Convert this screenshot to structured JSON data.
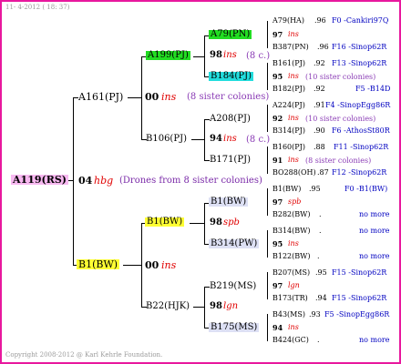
{
  "header_date": "11-  4-2012 ( 18: 37)",
  "copyright": "Copyright 2008-2012 @ Karl Kehrle Foundation.",
  "root": {
    "id": "A119(RS)",
    "year": "04",
    "breed": "hbg",
    "drones": "(Drones from 8 sister colonies)"
  },
  "p1": {
    "id": "A161(PJ)",
    "year": "00",
    "breed": "ins",
    "sisters": "(8 sister colonies)"
  },
  "p2": {
    "id": "B1(BW)",
    "year": "00",
    "breed": "ins"
  },
  "g1": {
    "id": "A199(PJ)",
    "year": "98",
    "breed": "ins",
    "sisters": "(8 c.)"
  },
  "g2": {
    "id": "B106(PJ)",
    "year": "94",
    "breed": "ins",
    "sisters": "(8 c.)"
  },
  "g3": {
    "id": "B1(BW)",
    "year": "98",
    "breed": "spb"
  },
  "g4": {
    "id": "B22(HJK)",
    "year": "98",
    "breed": "lgn"
  },
  "ggg": [
    {
      "id": "A79(PN)"
    },
    {
      "id": "B184(PJ)"
    },
    {
      "id": "A208(PJ)"
    },
    {
      "id": "B171(PJ)"
    },
    {
      "id": "B1(BW)"
    },
    {
      "id": "B314(PW)"
    },
    {
      "id": "B219(MS)"
    },
    {
      "id": "B175(MS)"
    }
  ],
  "rows": [
    {
      "a": "A79(HA)",
      "n": ".96",
      "info": "F0 -Cankiri97Q"
    },
    {
      "y": "97",
      "br": "ins"
    },
    {
      "a": "B387(PN)",
      "n": ".96",
      "info": "F16 -Sinop62R"
    },
    {
      "a": "B161(PJ)",
      "n": ".92",
      "info": "F13 -Sinop62R"
    },
    {
      "y": "95",
      "br": "ins",
      "sis": "(10 sister colonies)"
    },
    {
      "a": "B182(PJ)",
      "n": ".92",
      "info": "F5 -B14D"
    },
    {
      "a": "A224(PJ)",
      "n": ".91",
      "info": "F4 -SinopEgg86R"
    },
    {
      "y": "92",
      "br": "ins",
      "sis": "(10 sister colonies)"
    },
    {
      "a": "B314(PJ)",
      "n": ".90",
      "info": "F6 -AthosSt80R"
    },
    {
      "a": "B160(PJ)",
      "n": ".88",
      "info": "F11 -Sinop62R"
    },
    {
      "y": "91",
      "br": "ins",
      "sis": "(8 sister colonies)"
    },
    {
      "a": "BO288(OH)",
      "n": ".87",
      "info": "F12 -Sinop62R"
    },
    {
      "a": "B1(BW)",
      "n": ".95",
      "info": "F0 -B1(BW)"
    },
    {
      "y": "97",
      "br": "spb"
    },
    {
      "a": "B282(BW)",
      "n": ".",
      "info": "no more"
    },
    {
      "a": "B314(BW)",
      "n": ".",
      "info": "no more"
    },
    {
      "y": "95",
      "br": "ins"
    },
    {
      "a": "B122(BW)",
      "n": ".",
      "info": "no more"
    },
    {
      "a": "B207(MS)",
      "n": ".95",
      "info": "F15 -Sinop62R"
    },
    {
      "y": "97",
      "br": "lgn"
    },
    {
      "a": "B173(TR)",
      "n": ".94",
      "info": "F15 -Sinop62R"
    },
    {
      "a": "B43(MS)",
      "n": ".93",
      "info": "F5 -SinopEgg86R"
    },
    {
      "y": "94",
      "br": "ins"
    },
    {
      "a": "B424(GC)",
      "n": ".",
      "info": "no more"
    }
  ],
  "colors": {
    "border": "#e8189e",
    "root_highlight": "#f7b8f0",
    "yellow": "#ffff33",
    "green": "#22dd22",
    "cyan": "#22dddd",
    "breed": "#e00000",
    "sisters": "#8a3bb5",
    "link_blue": "#0000c0"
  }
}
